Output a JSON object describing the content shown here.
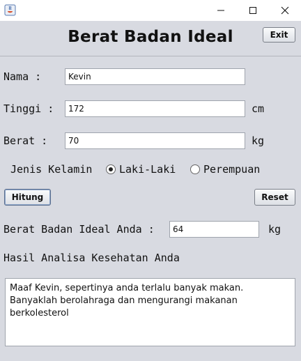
{
  "heading": "Berat Badan Ideal",
  "buttons": {
    "exit": "Exit",
    "hitung": "Hitung",
    "reset": "Reset"
  },
  "form": {
    "nama": {
      "label": "Nama :",
      "value": "Kevin"
    },
    "tinggi": {
      "label": "Tinggi :",
      "value": "172",
      "unit": "cm"
    },
    "berat": {
      "label": "Berat :",
      "value": "70",
      "unit": "kg"
    },
    "gender": {
      "label": "Jenis Kelamin",
      "options": [
        "Laki-Laki",
        "Perempuan"
      ],
      "selected": "Laki-Laki"
    }
  },
  "result": {
    "ideal_label": "Berat Badan Ideal Anda :",
    "ideal_value": "64",
    "ideal_unit": "kg",
    "analysis_label": "Hasil Analisa Kesehatan Anda",
    "analysis_lines": [
      "Maaf Kevin, sepertinya anda terlalu banyak makan.",
      "Banyaklah berolahraga dan mengurangi makanan berkolesterol"
    ]
  },
  "icons": {
    "app": "java-app-icon",
    "minimize": "minimize-icon",
    "maximize": "maximize-icon",
    "close": "close-icon"
  }
}
